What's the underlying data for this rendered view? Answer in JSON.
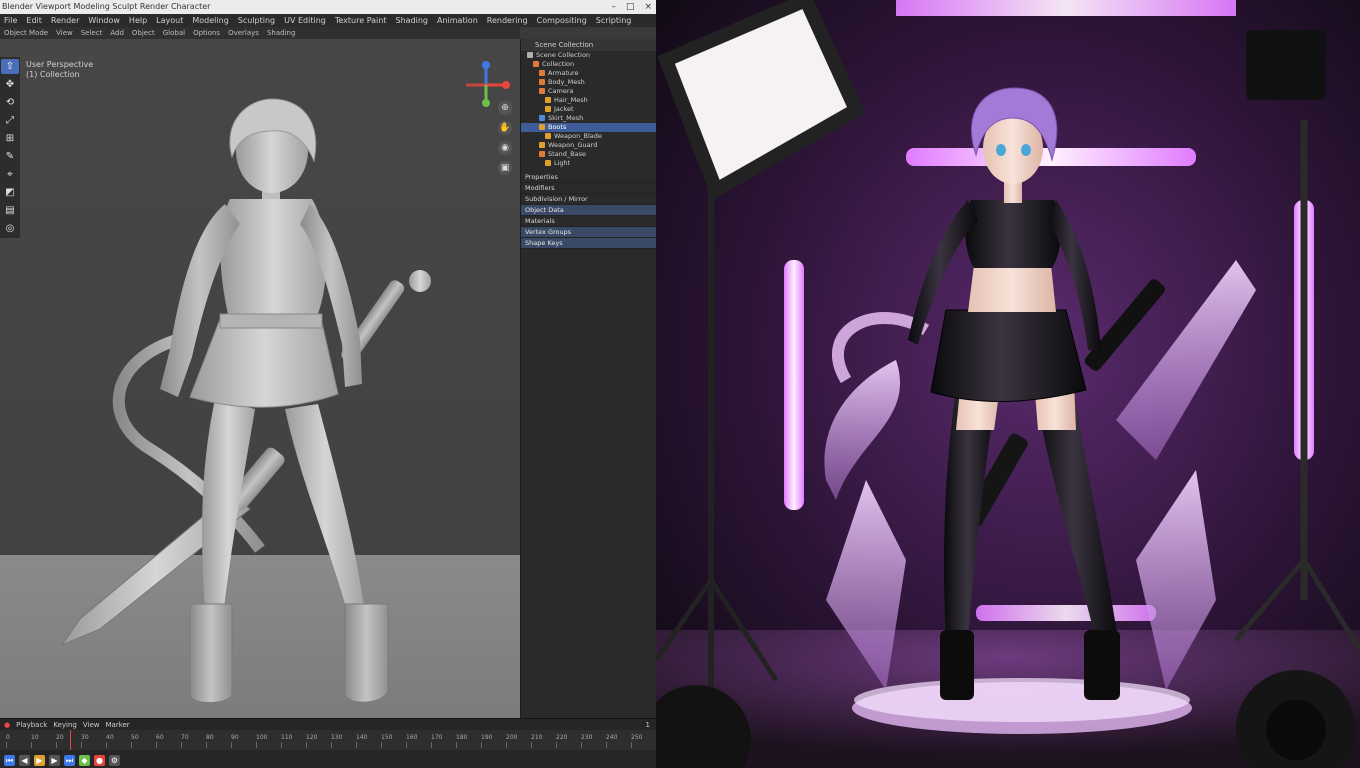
{
  "editor": {
    "titlebar": {
      "text": "Blender  Viewport  Modeling  Sculpt  Render  Character",
      "controls": [
        "–",
        "□",
        "×"
      ]
    },
    "menubar": [
      "File",
      "Edit",
      "Render",
      "Window",
      "Help",
      "Layout",
      "Modeling",
      "Sculpting",
      "UV Editing",
      "Texture Paint",
      "Shading",
      "Animation",
      "Rendering",
      "Compositing",
      "Scripting"
    ],
    "header": [
      "Object Mode",
      "View",
      "Select",
      "Add",
      "Object",
      "Global",
      "Options",
      "Overlays",
      "Shading"
    ],
    "viewport": {
      "info_line1": "User Perspective",
      "info_line2": "(1) Collection"
    },
    "tools": [
      "⇧",
      "✥",
      "⟲",
      "⤢",
      "⊞",
      "✎",
      "⌖",
      "◩",
      "▤",
      "◎"
    ],
    "nav_buttons": [
      "⊕",
      "✋",
      "◉",
      "▣"
    ],
    "outliner": {
      "header": "Scene Collection",
      "rows": [
        {
          "label": "Scene Collection",
          "depth": 0,
          "color": "#b0b0b0",
          "selected": false
        },
        {
          "label": "Collection",
          "depth": 1,
          "color": "#e07b39",
          "selected": false
        },
        {
          "label": "Armature",
          "depth": 2,
          "color": "#e07b39",
          "selected": false
        },
        {
          "label": "Body_Mesh",
          "depth": 2,
          "color": "#e07b39",
          "selected": false
        },
        {
          "label": "Camera",
          "depth": 2,
          "color": "#e07b39",
          "selected": false
        },
        {
          "label": "Hair_Mesh",
          "depth": 3,
          "color": "#e0a030",
          "selected": false
        },
        {
          "label": "Jacket",
          "depth": 3,
          "color": "#e0a030",
          "selected": false
        },
        {
          "label": "Skirt_Mesh",
          "depth": 2,
          "color": "#4f8ad8",
          "selected": false
        },
        {
          "label": "Boots",
          "depth": 2,
          "color": "#e0a030",
          "selected": true
        },
        {
          "label": "Weapon_Blade",
          "depth": 3,
          "color": "#e0a030",
          "selected": false
        },
        {
          "label": "Weapon_Guard",
          "depth": 2,
          "color": "#e0a030",
          "selected": false
        },
        {
          "label": "Stand_Base",
          "depth": 2,
          "color": "#e07b39",
          "selected": false
        },
        {
          "label": "Light",
          "depth": 3,
          "color": "#e0a030",
          "selected": false
        }
      ],
      "props": [
        {
          "label": "Properties",
          "hl": false
        },
        {
          "label": "Modifiers",
          "hl": false
        },
        {
          "label": "Subdivision / Mirror",
          "hl": false
        },
        {
          "label": "Object Data",
          "hl": true
        },
        {
          "label": "Materials",
          "hl": false
        },
        {
          "label": "Vertex Groups",
          "hl": true
        },
        {
          "label": "Shape Keys",
          "hl": true
        }
      ]
    },
    "timeline": {
      "head": [
        "Playback",
        "Keying",
        "View",
        "Marker"
      ],
      "ticks": [
        "0",
        "10",
        "20",
        "30",
        "40",
        "50",
        "60",
        "70",
        "80",
        "90",
        "100",
        "110",
        "120",
        "130",
        "140",
        "150",
        "160",
        "170",
        "180",
        "190",
        "200",
        "210",
        "220",
        "230",
        "240",
        "250"
      ],
      "frame": "1"
    },
    "colors": {
      "accent": "#4a6fb8",
      "axis_x": "#e8453c",
      "axis_y": "#6cc04a",
      "axis_z": "#3c78e8"
    }
  },
  "photo": {
    "alt": ""
  }
}
